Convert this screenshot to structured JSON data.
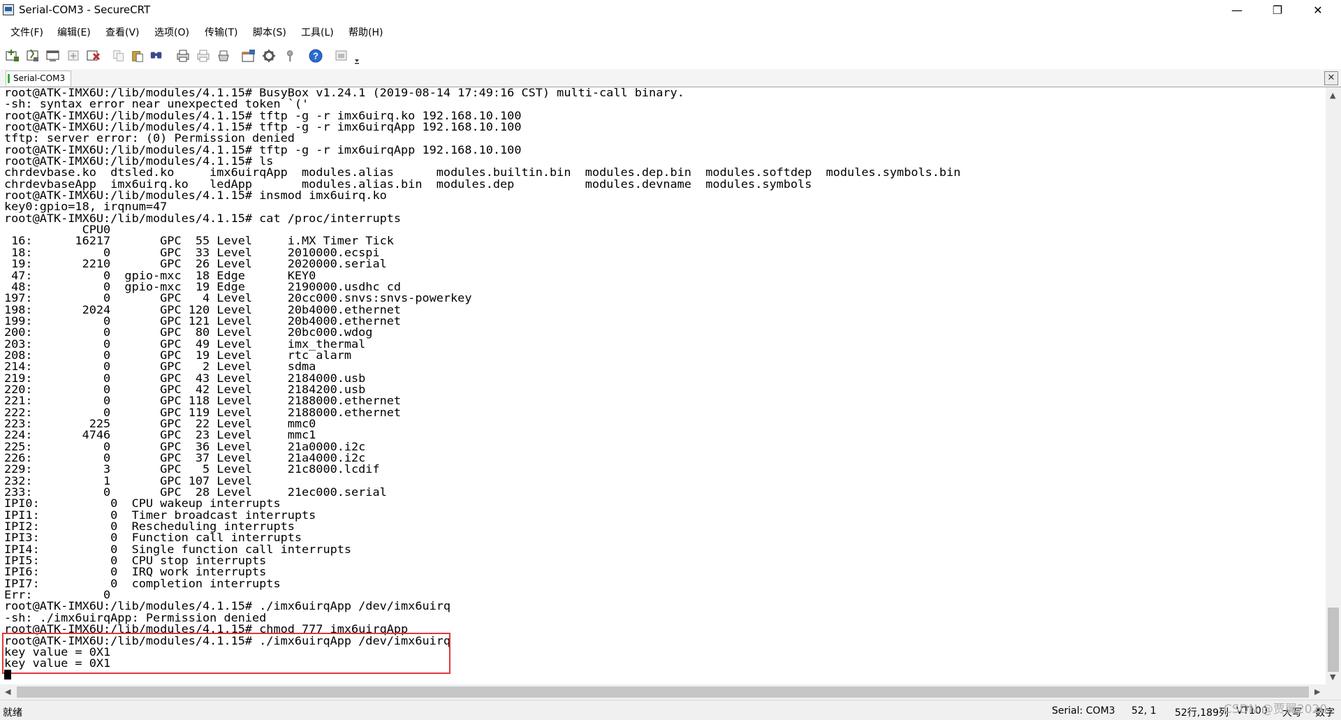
{
  "window": {
    "title": "Serial-COM3 - SecureCRT",
    "controls": {
      "minimize": "—",
      "maximize": "❐",
      "close": "✕"
    }
  },
  "menu": [
    {
      "label": "文件(F)",
      "name": "menu-file"
    },
    {
      "label": "编辑(E)",
      "name": "menu-edit"
    },
    {
      "label": "查看(V)",
      "name": "menu-view"
    },
    {
      "label": "选项(O)",
      "name": "menu-options"
    },
    {
      "label": "传输(T)",
      "name": "menu-transfer"
    },
    {
      "label": "脚本(S)",
      "name": "menu-script"
    },
    {
      "label": "工具(L)",
      "name": "menu-tools"
    },
    {
      "label": "帮助(H)",
      "name": "menu-help"
    }
  ],
  "toolbar": {
    "icons": [
      {
        "name": "connect-icon",
        "color": "#4a7a2a"
      },
      {
        "name": "quick-connect-icon",
        "color": "#4a7a2a"
      },
      {
        "name": "connect-in-tab-icon",
        "color": "#5a5a5a"
      },
      {
        "name": "reconnect-icon",
        "color": "#8a8a8a"
      },
      {
        "name": "disconnect-icon",
        "color": "#c03030"
      },
      {
        "name": "copy-icon",
        "color": "#9a9a9a"
      },
      {
        "name": "paste-icon",
        "color": "#c8a040"
      },
      {
        "name": "find-icon",
        "color": "#3a4a8a"
      },
      {
        "name": "print-icon",
        "color": "#4a4a4a"
      },
      {
        "name": "print-selection-icon",
        "color": "#8a8a8a"
      },
      {
        "name": "print-setup-icon",
        "color": "#6a6a6a"
      },
      {
        "name": "session-options-icon",
        "color": "#c07a30"
      },
      {
        "name": "global-options-icon",
        "color": "#5a5a5a"
      },
      {
        "name": "keymap-icon",
        "color": "#8a8a8a"
      },
      {
        "name": "help-icon",
        "color": "#2a6ad0"
      },
      {
        "name": "customize-toolbar-icon",
        "color": "#9a9a9a"
      }
    ]
  },
  "tabs": [
    {
      "label": "Serial-COM3",
      "active": true
    }
  ],
  "tab_close": "✕",
  "terminal": {
    "lines": [
      "root@ATK-IMX6U:/lib/modules/4.1.15# BusyBox v1.24.1 (2019-08-14 17:49:16 CST) multi-call binary.",
      "-sh: syntax error near unexpected token `('",
      "root@ATK-IMX6U:/lib/modules/4.1.15# tftp -g -r imx6uirq.ko 192.168.10.100",
      "root@ATK-IMX6U:/lib/modules/4.1.15# tftp -g -r imx6uirqApp 192.168.10.100",
      "tftp: server error: (0) Permission denied",
      "root@ATK-IMX6U:/lib/modules/4.1.15# tftp -g -r imx6uirqApp 192.168.10.100",
      "root@ATK-IMX6U:/lib/modules/4.1.15# ls",
      "chrdevbase.ko  dtsled.ko     imx6uirqApp  modules.alias      modules.builtin.bin  modules.dep.bin  modules.softdep  modules.symbols.bin",
      "chrdevbaseApp  imx6uirq.ko   ledApp       modules.alias.bin  modules.dep          modules.devname  modules.symbols",
      "root@ATK-IMX6U:/lib/modules/4.1.15# insmod imx6uirq.ko",
      "key0:gpio=18, irqnum=47",
      "root@ATK-IMX6U:/lib/modules/4.1.15# cat /proc/interrupts",
      "           CPU0",
      " 16:      16217       GPC  55 Level     i.MX Timer Tick",
      " 18:          0       GPC  33 Level     2010000.ecspi",
      " 19:       2210       GPC  26 Level     2020000.serial",
      " 47:          0  gpio-mxc  18 Edge      KEY0",
      " 48:          0  gpio-mxc  19 Edge      2190000.usdhc cd",
      "197:          0       GPC   4 Level     20cc000.snvs:snvs-powerkey",
      "198:       2024       GPC 120 Level     20b4000.ethernet",
      "199:          0       GPC 121 Level     20b4000.ethernet",
      "200:          0       GPC  80 Level     20bc000.wdog",
      "203:          0       GPC  49 Level     imx_thermal",
      "208:          0       GPC  19 Level     rtc alarm",
      "214:          0       GPC   2 Level     sdma",
      "219:          0       GPC  43 Level     2184000.usb",
      "220:          0       GPC  42 Level     2184200.usb",
      "221:          0       GPC 118 Level     2188000.ethernet",
      "222:          0       GPC 119 Level     2188000.ethernet",
      "223:        225       GPC  22 Level     mmc0",
      "224:       4746       GPC  23 Level     mmc1",
      "225:          0       GPC  36 Level     21a0000.i2c",
      "226:          0       GPC  37 Level     21a4000.i2c",
      "229:          3       GPC   5 Level     21c8000.lcdif",
      "232:          1       GPC 107 Level",
      "233:          0       GPC  28 Level     21ec000.serial",
      "IPI0:          0  CPU wakeup interrupts",
      "IPI1:          0  Timer broadcast interrupts",
      "IPI2:          0  Rescheduling interrupts",
      "IPI3:          0  Function call interrupts",
      "IPI4:          0  Single function call interrupts",
      "IPI5:          0  CPU stop interrupts",
      "IPI6:          0  IRQ work interrupts",
      "IPI7:          0  completion interrupts",
      "Err:          0",
      "root@ATK-IMX6U:/lib/modules/4.1.15# ./imx6uirqApp /dev/imx6uirq",
      "-sh: ./imx6uirqApp: Permission denied",
      "root@ATK-IMX6U:/lib/modules/4.1.15# chmod 777 imx6uirqApp",
      "root@ATK-IMX6U:/lib/modules/4.1.15# ./imx6uirqApp /dev/imx6uirq",
      "key value = 0X1",
      "key value = 0X1"
    ],
    "highlight_color": "#e33838"
  },
  "scroll": {
    "up": "▲",
    "down": "▼",
    "left": "◀",
    "right": "▶"
  },
  "status": {
    "ready": "就绪",
    "connection": "Serial: COM3",
    "position": "52,   1",
    "size": "52行,189列",
    "emulation": "VT100",
    "caps": "大写",
    "num": "数字"
  },
  "watermark": "CSDN @贾翼2020"
}
